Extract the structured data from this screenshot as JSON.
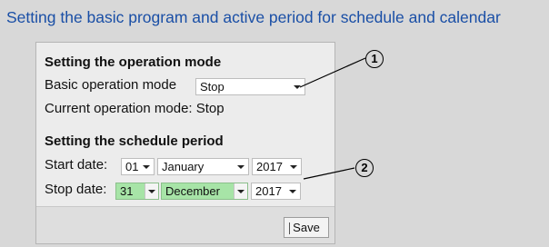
{
  "page": {
    "heading": "Setting the basic program and active period for schedule and calendar"
  },
  "operation": {
    "section_title": "Setting the operation mode",
    "basic_label": "Basic operation mode",
    "basic_value": "Stop",
    "current_label": "Current operation mode: Stop"
  },
  "schedule": {
    "section_title": "Setting the schedule period",
    "start_label": "Start date:",
    "start_day": "01",
    "start_month": "January",
    "start_year": "2017",
    "stop_label": "Stop date:",
    "stop_day": "31",
    "stop_month": "December",
    "stop_year": "2017"
  },
  "footer": {
    "save_label": "Save"
  },
  "callouts": {
    "one": "1",
    "two": "2"
  },
  "colors": {
    "heading": "#1a4fa6",
    "highlight": "#a7e4a7",
    "background": "#d8d8d8",
    "panel": "#ececec"
  }
}
